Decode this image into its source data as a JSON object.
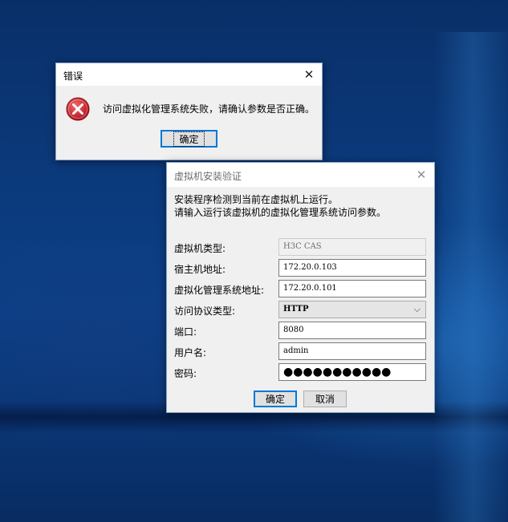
{
  "error_dialog": {
    "title": "错误",
    "close_glyph": "✕",
    "icon": "error-icon",
    "message": "访问虚拟化管理系统失败，请确认参数是否正确。",
    "ok_label": "确定"
  },
  "install_dialog": {
    "title": "虚拟机安装验证",
    "close_glyph": "✕",
    "intro_line1": "安装程序检测到当前在虚拟机上运行。",
    "intro_line2": "请输入运行该虚拟机的虚拟化管理系统访问参数。",
    "fields": {
      "vm_type": {
        "label": "虚拟机类型:",
        "value": "H3C CAS"
      },
      "host_address": {
        "label": "宿主机地址:",
        "value": "172.20.0.103"
      },
      "mgmt_address": {
        "label": "虚拟化管理系统地址:",
        "value": "172.20.0.101"
      },
      "protocol": {
        "label": "访问协议类型:",
        "value": "HTTP"
      },
      "port": {
        "label": "端口:",
        "value": "8080"
      },
      "username": {
        "label": "用户名:",
        "value": "admin"
      },
      "password": {
        "label": "密码:",
        "value": "●●●●●●●●●●●"
      }
    },
    "ok_label": "确定",
    "cancel_label": "取消"
  },
  "colors": {
    "desktop_blue": "#0b3a7c",
    "dialog_bg": "#f0f0f0",
    "accent": "#0078d7",
    "error_red": "#c8202c"
  }
}
